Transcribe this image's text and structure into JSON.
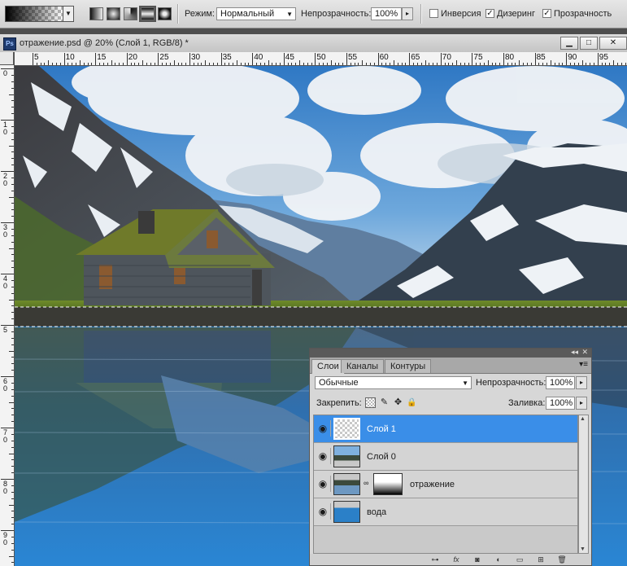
{
  "options_bar": {
    "mode_label": "Режим:",
    "mode_value": "Нормальный",
    "opacity_label": "Непрозрачность:",
    "opacity_value": "100%",
    "reverse_label": "Инверсия",
    "reverse_checked": false,
    "dither_label": "Дизеринг",
    "dither_checked": true,
    "transparency_label": "Прозрачность",
    "transparency_checked": true,
    "gradient_types": [
      "linear-gradient-icon",
      "radial-gradient-icon",
      "angle-gradient-icon",
      "reflected-gradient-icon",
      "diamond-gradient-icon"
    ],
    "selected_gradient_type": 3
  },
  "document": {
    "title": "отражение.psd @ 20% (Слой 1, RGB/8) *",
    "ps_icon_text": "Ps"
  },
  "rulers": {
    "h_labels": [
      "5",
      "10",
      "15",
      "20",
      "25",
      "30",
      "35",
      "40",
      "45",
      "50",
      "55",
      "60",
      "65",
      "70",
      "75",
      "80",
      "85",
      "90",
      "95"
    ],
    "v_labels": [
      "0",
      "1\n0",
      "2\n0",
      "3\n0",
      "4\n0",
      "5",
      "6\n0",
      "7\n0",
      "8\n0",
      "9\n0"
    ]
  },
  "layers_panel": {
    "tabs": [
      "Слои",
      "Каналы",
      "Контуры"
    ],
    "active_tab": 0,
    "blend_mode": "Обычные",
    "opacity_label": "Непрозрачность:",
    "opacity_value": "100%",
    "lock_label": "Закрепить:",
    "fill_label": "Заливка:",
    "fill_value": "100%",
    "layers": [
      {
        "name": "Слой 1",
        "selected": true,
        "thumb": "transparent",
        "mask": false
      },
      {
        "name": "Слой 0",
        "selected": false,
        "thumb": "scene",
        "mask": false
      },
      {
        "name": "отражение",
        "selected": false,
        "thumb": "scene-reflection",
        "mask": true
      },
      {
        "name": "вода",
        "selected": false,
        "thumb": "water",
        "mask": false
      }
    ],
    "bottom_icons": [
      "link-layers-icon",
      "fx-icon",
      "mask-icon",
      "adjustment-icon",
      "folder-icon",
      "new-layer-icon",
      "trash-icon"
    ]
  },
  "colors": {
    "selection_blue": "#3a8ee8",
    "water_blue": "#2b80c8"
  }
}
